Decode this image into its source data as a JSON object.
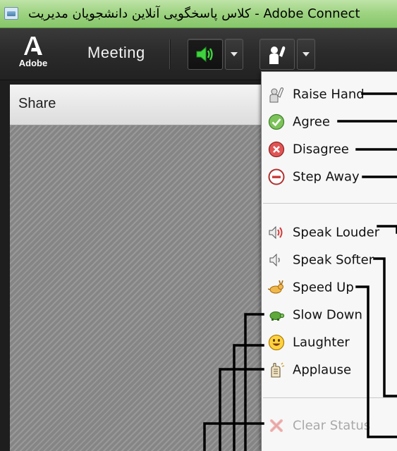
{
  "window": {
    "title": "کلاس پاسخگویی آنلاین دانشجویان مدیریت - Adobe Connect"
  },
  "toolbar": {
    "logo_text": "Adobe",
    "meeting_label": "Meeting",
    "audio_icon": "speaker-icon",
    "status_icon": "raise-hand-icon"
  },
  "share_pod": {
    "title": "Share"
  },
  "status_menu": {
    "group_primary": [
      {
        "label": "Raise Hand",
        "icon": "raise-hand-icon"
      },
      {
        "label": "Agree",
        "icon": "agree-check-icon"
      },
      {
        "label": "Disagree",
        "icon": "disagree-x-icon"
      },
      {
        "label": "Step Away",
        "icon": "step-away-icon"
      }
    ],
    "group_feedback": [
      {
        "label": "Speak Louder",
        "icon": "speak-louder-icon"
      },
      {
        "label": "Speak Softer",
        "icon": "speak-softer-icon"
      },
      {
        "label": "Speed Up",
        "icon": "speed-up-rabbit-icon"
      },
      {
        "label": "Slow Down",
        "icon": "slow-down-turtle-icon"
      },
      {
        "label": "Laughter",
        "icon": "laughter-smiley-icon"
      },
      {
        "label": "Applause",
        "icon": "applause-hands-icon"
      }
    ],
    "clear": {
      "label": "Clear Status",
      "icon": "clear-status-icon",
      "enabled": false
    }
  },
  "colors": {
    "titlebar": "#9fd483",
    "toolbar": "#2a2a2a",
    "audio_active": "#3fd43f",
    "menu_bg": "#f7f7f7",
    "disabled_text": "#a9a9a9"
  }
}
